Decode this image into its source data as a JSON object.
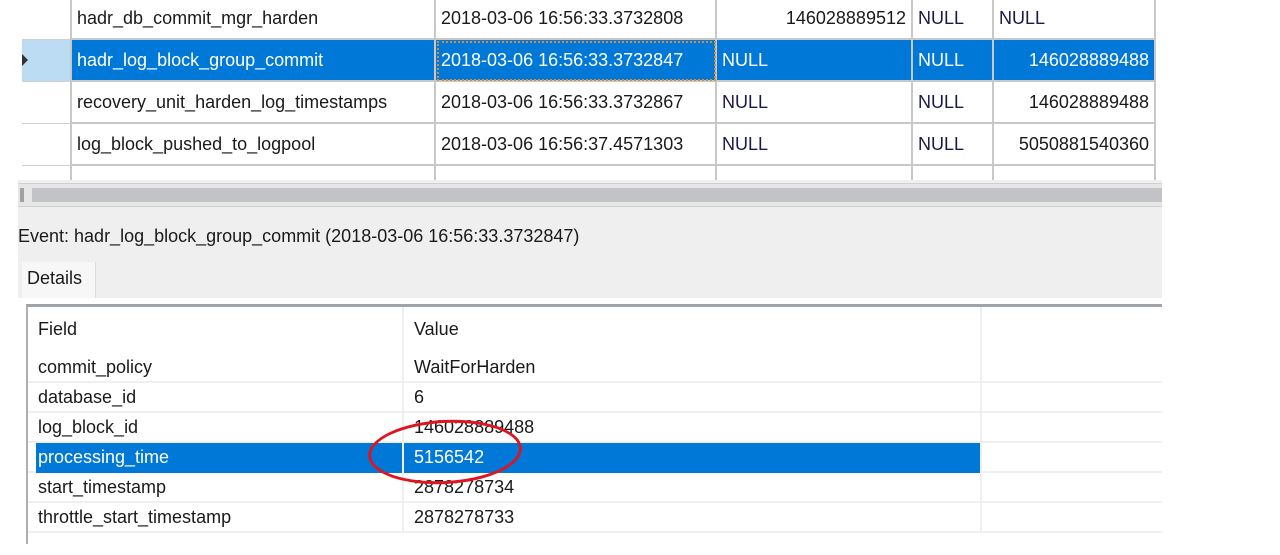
{
  "events_grid": {
    "rows": [
      {
        "name": "hadr_db_commit_mgr_harden",
        "timestamp": "2018-03-06 16:56:33.3732808",
        "col3": "146028889512",
        "col4": "NULL",
        "col5": "NULL",
        "selected": false
      },
      {
        "name": "hadr_log_block_group_commit",
        "timestamp": "2018-03-06 16:56:33.3732847",
        "col3": "NULL",
        "col4": "NULL",
        "col5": "146028889488",
        "selected": true
      },
      {
        "name": "recovery_unit_harden_log_timestamps",
        "timestamp": "2018-03-06 16:56:33.3732867",
        "col3": "NULL",
        "col4": "NULL",
        "col5": "146028889488",
        "selected": false
      },
      {
        "name": "log_block_pushed_to_logpool",
        "timestamp": "2018-03-06 16:56:37.4571303",
        "col3": "NULL",
        "col4": "NULL",
        "col5": "5050881540360",
        "selected": false
      }
    ]
  },
  "event_label": "Event: hadr_log_block_group_commit (2018-03-06 16:56:33.3732847)",
  "tabs": {
    "details": "Details"
  },
  "details": {
    "header": {
      "field": "Field",
      "value": "Value"
    },
    "rows": [
      {
        "field": "commit_policy",
        "value": "WaitForHarden"
      },
      {
        "field": "database_id",
        "value": "6"
      },
      {
        "field": "log_block_id",
        "value": "146028889488"
      },
      {
        "field": "processing_time",
        "value": "5156542"
      },
      {
        "field": "start_timestamp",
        "value": "2878278734"
      },
      {
        "field": "throttle_start_timestamp",
        "value": "2878278733"
      }
    ],
    "selected_index": 3
  },
  "colors": {
    "selection": "#0078d7",
    "annotation": "#e0141e"
  }
}
